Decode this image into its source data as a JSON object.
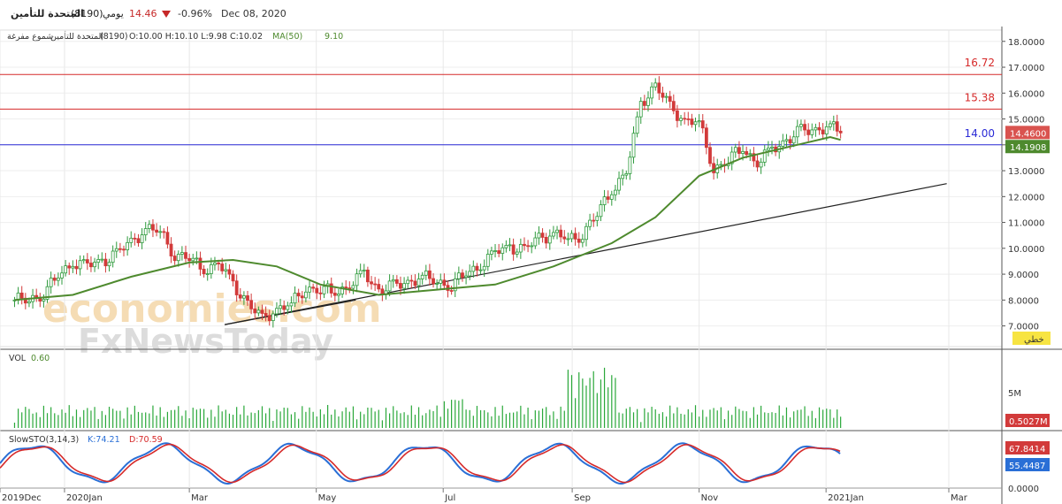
{
  "header": {
    "instrument": "المتحدة للتأمين",
    "code": "(8190)",
    "period": "يومي",
    "price": "14.46",
    "change": "-0.96%",
    "date": "Dec 08, 2020"
  },
  "legend": {
    "name": "المتحدة للتأمين",
    "code": "(8190)",
    "chart_kind": "شموع مفرغة",
    "ohlc": "O:10.00  H:10.10  L:9.98  C:10.02",
    "ma_label": "MA(50)",
    "ma_value": "9.10"
  },
  "watermark": {
    "line1": "economies.com",
    "line2": "FxNewsToday"
  },
  "colors": {
    "up": "#2e9a3c",
    "down": "#d23a3a",
    "ma": "#4e8a2e",
    "resistance": "#d62a2a",
    "support": "#2a2ad6",
    "trend": "#222222",
    "stoch_k": "#2a6fd6",
    "stoch_d": "#d62a2a",
    "volume": "#2aa83a"
  },
  "chart_data": {
    "type": "candlestick",
    "x_ticks": [
      "2019Dec",
      "2020Jan",
      "Mar",
      "May",
      "Jul",
      "Sep",
      "Nov",
      "2021Jan",
      "Mar"
    ],
    "price_axis": {
      "ticks": [
        "18.0000",
        "17.0000",
        "16.0000",
        "15.0000",
        "14.0000",
        "13.0000",
        "12.0000",
        "11.0000",
        "10.0000",
        "9.0000",
        "8.0000",
        "7.0000"
      ],
      "range": [
        6.2,
        18.3
      ]
    },
    "horizontal_lines": [
      {
        "label": "16.72",
        "value": 16.72,
        "color": "#d62a2a"
      },
      {
        "label": "15.38",
        "value": 15.38,
        "color": "#d62a2a"
      },
      {
        "label": "14.00",
        "value": 14.0,
        "color": "#2a2ad6"
      }
    ],
    "trendline": {
      "from": {
        "date": "2020-03-18",
        "value": 7.05
      },
      "to": {
        "date": "2021-02-28",
        "value": 12.5
      }
    },
    "short_segment": {
      "from": {
        "date": "2020-03-18",
        "value": 7.05
      },
      "to": {
        "date": "2020-05-20",
        "value": 8.0
      }
    },
    "last_price_label": "14.4600",
    "ma_label": "14.1908",
    "line_tool_label": "خطي",
    "close_series": [
      [
        "2019-12-08",
        8.0
      ],
      [
        "2019-12-15",
        8.0
      ],
      [
        "2019-12-22",
        8.3
      ],
      [
        "2019-12-29",
        8.9
      ],
      [
        "2020-01-05",
        9.5
      ],
      [
        "2020-01-12",
        9.3
      ],
      [
        "2020-01-19",
        9.5
      ],
      [
        "2020-01-26",
        9.8
      ],
      [
        "2020-02-02",
        10.2
      ],
      [
        "2020-02-09",
        10.8
      ],
      [
        "2020-02-16",
        10.6
      ],
      [
        "2020-02-23",
        9.8
      ],
      [
        "2020-03-01",
        9.6
      ],
      [
        "2020-03-08",
        9.2
      ],
      [
        "2020-03-15",
        9.4
      ],
      [
        "2020-03-22",
        8.6
      ],
      [
        "2020-03-29",
        7.9
      ],
      [
        "2020-04-05",
        7.2
      ],
      [
        "2020-04-12",
        7.7
      ],
      [
        "2020-04-19",
        7.8
      ],
      [
        "2020-04-26",
        8.5
      ],
      [
        "2020-05-03",
        8.4
      ],
      [
        "2020-05-10",
        8.3
      ],
      [
        "2020-05-17",
        8.6
      ],
      [
        "2020-05-24",
        9.0
      ],
      [
        "2020-05-31",
        8.4
      ],
      [
        "2020-06-07",
        8.5
      ],
      [
        "2020-06-14",
        8.7
      ],
      [
        "2020-06-21",
        8.9
      ],
      [
        "2020-06-28",
        8.7
      ],
      [
        "2020-07-05",
        8.6
      ],
      [
        "2020-07-12",
        9.0
      ],
      [
        "2020-07-19",
        9.4
      ],
      [
        "2020-07-26",
        9.8
      ],
      [
        "2020-08-02",
        10.1
      ],
      [
        "2020-08-09",
        9.9
      ],
      [
        "2020-08-16",
        10.4
      ],
      [
        "2020-08-23",
        10.6
      ],
      [
        "2020-08-30",
        10.3
      ],
      [
        "2020-09-06",
        10.6
      ],
      [
        "2020-09-13",
        11.3
      ],
      [
        "2020-09-20",
        12.3
      ],
      [
        "2020-09-27",
        12.9
      ],
      [
        "2020-10-04",
        15.6
      ],
      [
        "2020-10-11",
        16.3
      ],
      [
        "2020-10-18",
        15.4
      ],
      [
        "2020-10-25",
        15.0
      ],
      [
        "2020-11-01",
        14.8
      ],
      [
        "2020-11-08",
        13.1
      ],
      [
        "2020-11-15",
        13.4
      ],
      [
        "2020-11-22",
        13.9
      ],
      [
        "2020-11-29",
        13.3
      ],
      [
        "2020-12-06",
        13.8
      ],
      [
        "2020-12-13",
        14.2
      ],
      [
        "2020-12-20",
        14.5
      ],
      [
        "2020-12-27",
        14.6
      ],
      [
        "2021-01-03",
        14.7
      ],
      [
        "2021-01-08",
        14.46
      ]
    ],
    "ma50_series": [
      [
        "2019-12-08",
        8.0
      ],
      [
        "2020-01-05",
        8.2
      ],
      [
        "2020-02-02",
        8.9
      ],
      [
        "2020-03-01",
        9.45
      ],
      [
        "2020-03-22",
        9.55
      ],
      [
        "2020-04-12",
        9.3
      ],
      [
        "2020-05-03",
        8.6
      ],
      [
        "2020-05-31",
        8.2
      ],
      [
        "2020-06-28",
        8.4
      ],
      [
        "2020-07-26",
        8.6
      ],
      [
        "2020-08-23",
        9.3
      ],
      [
        "2020-09-20",
        10.2
      ],
      [
        "2020-10-11",
        11.2
      ],
      [
        "2020-11-01",
        12.8
      ],
      [
        "2020-11-22",
        13.5
      ],
      [
        "2020-12-13",
        13.9
      ],
      [
        "2021-01-03",
        14.3
      ],
      [
        "2021-01-08",
        14.19
      ]
    ],
    "volume": {
      "label": "VOL",
      "value": "0.60",
      "axis_tick": "5M",
      "last_label": "0.5027M"
    },
    "stochastic": {
      "label": "SlowSTO(3,14,3)",
      "k_label": "K:74.21",
      "d_label": "D:70.59",
      "k_value": "67.8414",
      "d_value": "55.4487",
      "axis_tick": "0.0000"
    }
  }
}
